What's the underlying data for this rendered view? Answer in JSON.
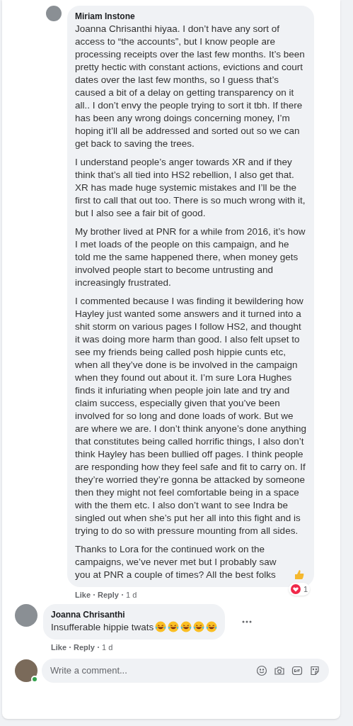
{
  "comments": [
    {
      "author": "Miriam Instone",
      "nested": true,
      "paragraphs": [
        "Joanna Chrisanthi hiyaa. I don’t have any sort of access to “the accounts”, but I know people are processing receipts over the last few months. It’s been pretty hectic with constant actions, evictions and court dates over the last few months, so I guess that’s caused a bit of a delay on getting transparency on it all.. I don’t envy the people trying to sort it tbh. If there has been any wrong doings concerning money, I’m hoping it’ll all be addressed and sorted out so we can get back to saving the trees.",
        "I understand people’s anger towards XR and if they think that’s all tied into HS2 rebellion, I also get that. XR has made huge systemic mistakes and I’ll be the first to call that out too. There is so much wrong with it, but I also see a fair bit of good.",
        "My brother lived at PNR for a while from 2016, it’s how I met loads of the people on this campaign, and he told me the same happened there, when money gets involved people start to become untrusting and increasingly frustrated.",
        "I commented because I was finding it bewildering how Hayley just wanted some answers and it turned into a shit storm on various pages I follow HS2, and thought it was doing more harm than good. I also felt upset to see my friends being called posh hippie cunts etc, when all they’ve done is be involved in the campaign when they found out about it. I’m sure Lora Hughes finds it infuriating when people join late and try and claim success, especially given that you’ve been involved for so long and done loads of work. But we are where we are. I don’t think anyone’s done anything that constitutes being called horrific things, I also don’t think Hayley has been bullied off pages. I think people are responding how they feel safe and fit to carry on. If they’re worried they’re gonna be attacked by someone then they might not feel comfortable being in a space with the them etc. I also don’t want to see Indra be singled out when she’s put her all into this fight and is trying to do so with pressure mounting from all sides.",
        "Thanks to Lora for the continued work on the campaigns, we’ve never met but I probably saw you at PNR a couple of times? All the best folks"
      ],
      "reaction_count": "1",
      "actions": [
        "Like",
        "Reply"
      ],
      "time": "1 d"
    },
    {
      "author": "Joanna Chrisanthi",
      "nested": false,
      "paragraphs": [
        "Insufferable hippie twats"
      ],
      "actions": [
        "Like",
        "Reply"
      ],
      "time": "1 d"
    }
  ],
  "composer": {
    "placeholder": "Write a comment...",
    "online": true
  }
}
